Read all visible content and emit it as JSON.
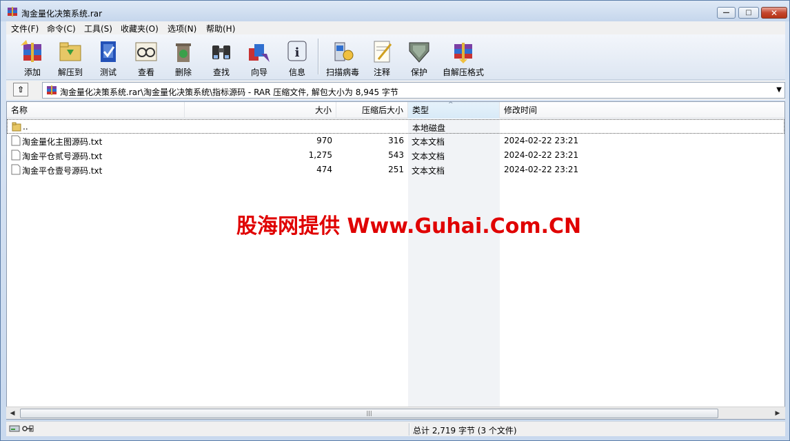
{
  "window": {
    "title": "淘金量化决策系统.rar"
  },
  "menu": [
    "文件(F)",
    "命令(C)",
    "工具(S)",
    "收藏夹(O)",
    "选项(N)",
    "帮助(H)"
  ],
  "toolbar": {
    "add": "添加",
    "extract": "解压到",
    "test": "测试",
    "view": "查看",
    "delete": "删除",
    "find": "查找",
    "wizard": "向导",
    "info": "信息",
    "scan": "扫描病毒",
    "comment": "注释",
    "protect": "保护",
    "sfx": "自解压格式"
  },
  "address": {
    "text": "淘金量化决策系统.rar\\淘金量化决策系统\\指标源码 - RAR 压缩文件, 解包大小为 8,945 字节"
  },
  "columns": {
    "name": "名称",
    "size": "大小",
    "packed": "压缩后大小",
    "type": "类型",
    "modified": "修改时间"
  },
  "rows": [
    {
      "name": "..",
      "size": "",
      "packed": "",
      "type": "本地磁盘",
      "modified": ""
    },
    {
      "name": "淘金量化主图源码.txt",
      "size": "970",
      "packed": "316",
      "type": "文本文档",
      "modified": "2024-02-22 23:21"
    },
    {
      "name": "淘金平仓贰号源码.txt",
      "size": "1,275",
      "packed": "543",
      "type": "文本文档",
      "modified": "2024-02-22 23:21"
    },
    {
      "name": "淘金平仓壹号源码.txt",
      "size": "474",
      "packed": "251",
      "type": "文本文档",
      "modified": "2024-02-22 23:21"
    }
  ],
  "watermark": "股海网提供 Www.Guhai.Com.CN",
  "status": {
    "total": "总计 2,719 字节 (3 个文件)"
  }
}
